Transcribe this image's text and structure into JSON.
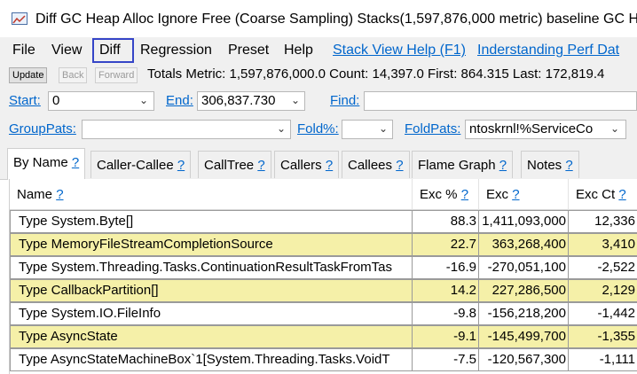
{
  "window": {
    "title": "Diff GC Heap Alloc Ignore Free (Coarse Sampling) Stacks(1,597,876,000 metric) baseline GC H"
  },
  "menu": {
    "file": "File",
    "view": "View",
    "diff": "Diff",
    "regression": "Regression",
    "preset": "Preset",
    "help": "Help",
    "link_stack_view_help": "Stack View Help (F1)",
    "link_understanding": "Inderstanding Perf Dat"
  },
  "toolbar": {
    "update": "Update",
    "back": "Back",
    "forward": "Forward",
    "totals": "Totals Metric: 1,597,876,000.0  Count: 14,397.0  First: 864.315 Last: 172,819.4"
  },
  "range": {
    "start_label": "Start:",
    "start_value": "0",
    "end_label": "End:",
    "end_value": "306,837.730",
    "find_label": "Find:"
  },
  "grouping": {
    "grouppats_label": "GroupPats:",
    "fold_label": "Fold%:",
    "foldpats_label": "FoldPats:",
    "foldpats_value": "ntoskrnl!%ServiceCo"
  },
  "tabs": [
    {
      "label": "By Name",
      "help": "?"
    },
    {
      "label": "Caller-Callee",
      "help": "?"
    },
    {
      "label": "CallTree",
      "help": "?"
    },
    {
      "label": "Callers",
      "help": "?"
    },
    {
      "label": "Callees",
      "help": "?"
    },
    {
      "label": "Flame Graph",
      "help": "?"
    },
    {
      "label": "Notes",
      "help": "?"
    }
  ],
  "grid": {
    "columns": [
      {
        "label": "Name",
        "help": "?"
      },
      {
        "label": "Exc %",
        "help": "?"
      },
      {
        "label": "Exc",
        "help": "?"
      },
      {
        "label": "Exc Ct",
        "help": "?"
      }
    ],
    "rows": [
      {
        "name": "Type System.Byte[]",
        "exc_pct": "88.3",
        "exc": "1,411,093,000",
        "exc_ct": "12,336"
      },
      {
        "name": "Type MemoryFileStreamCompletionSource",
        "exc_pct": "22.7",
        "exc": "363,268,400",
        "exc_ct": "3,410"
      },
      {
        "name": "Type System.Threading.Tasks.ContinuationResultTaskFromTas",
        "exc_pct": "-16.9",
        "exc": "-270,051,100",
        "exc_ct": "-2,522"
      },
      {
        "name": "Type CallbackPartition[]",
        "exc_pct": "14.2",
        "exc": "227,286,500",
        "exc_ct": "2,129"
      },
      {
        "name": "Type System.IO.FileInfo",
        "exc_pct": "-9.8",
        "exc": "-156,218,200",
        "exc_ct": "-1,442"
      },
      {
        "name": "Type AsyncState",
        "exc_pct": "-9.1",
        "exc": "-145,499,700",
        "exc_ct": "-1,355"
      },
      {
        "name": "Type AsyncStateMachineBox`1[System.Threading.Tasks.VoidT",
        "exc_pct": "-7.5",
        "exc": "-120,567,300",
        "exc_ct": "-1,111"
      }
    ]
  },
  "colors": {
    "highlight_row": "#f5f0a8",
    "link": "#0066cc",
    "diff_outline": "#3545c7"
  }
}
